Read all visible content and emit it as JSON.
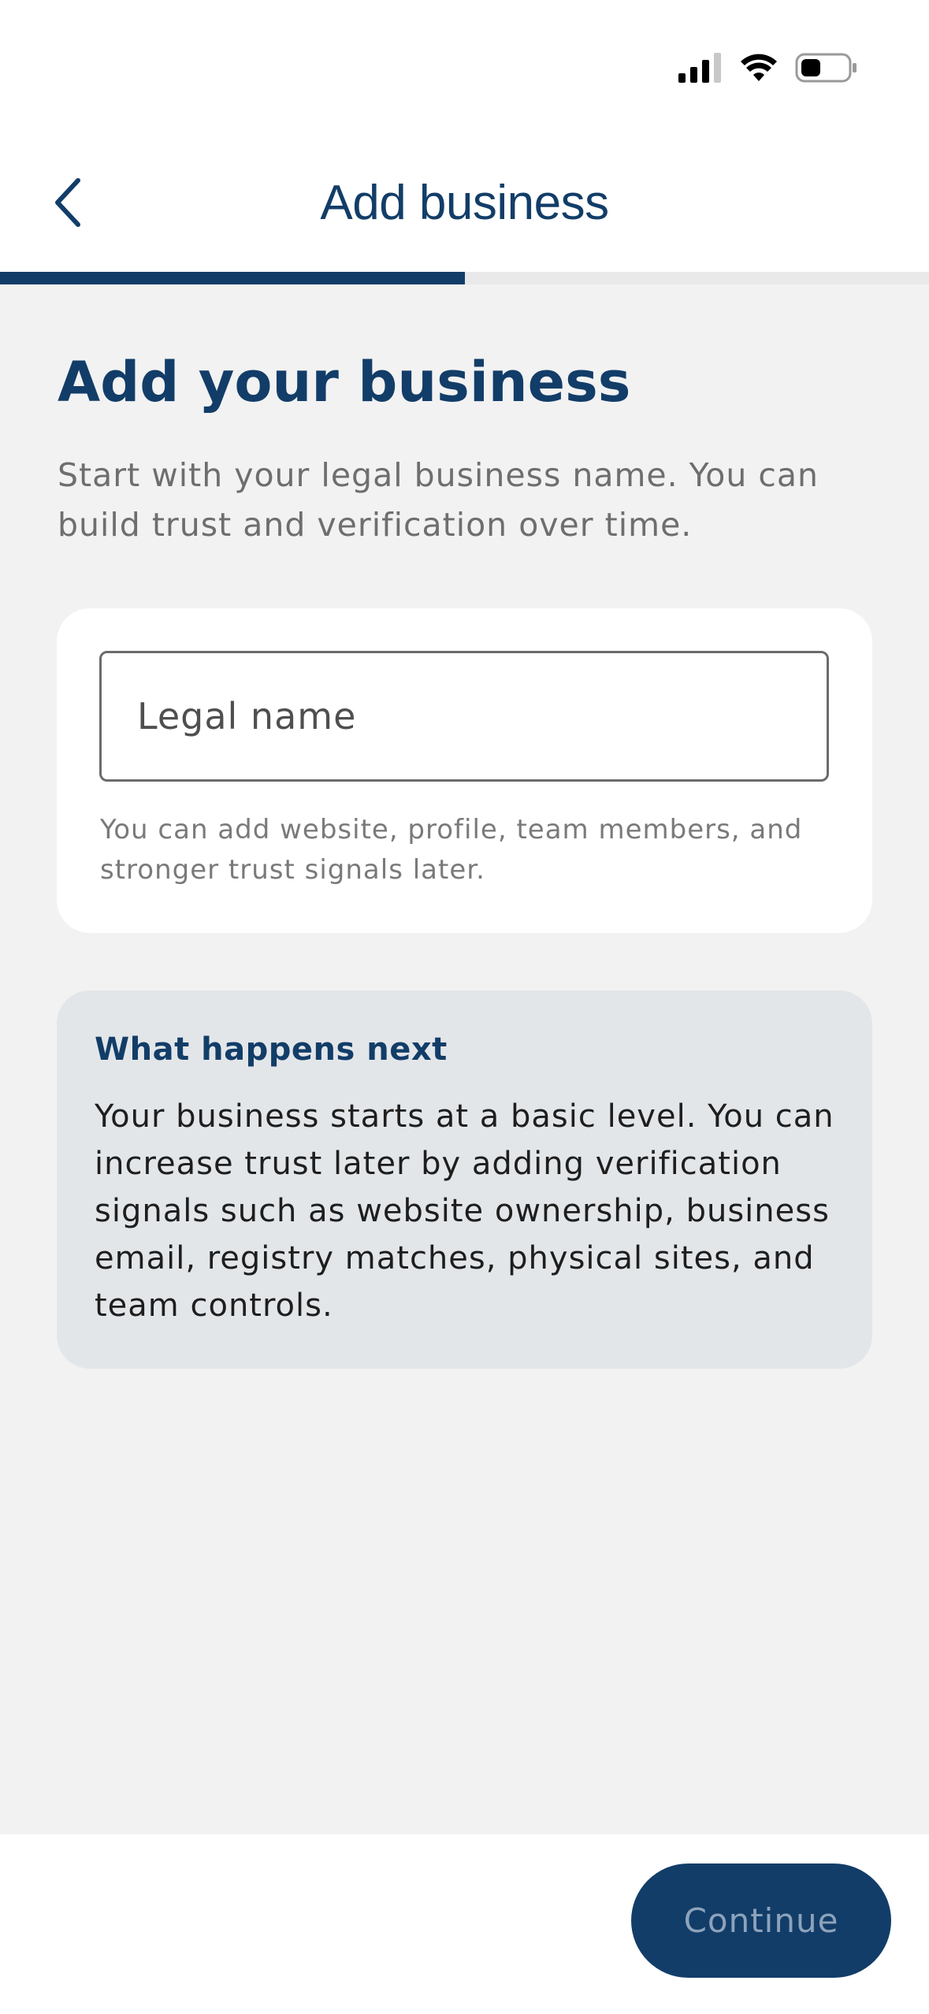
{
  "header": {
    "title": "Add business",
    "back_icon": "chevron-left-icon"
  },
  "status_bar": {
    "icons": [
      "cellular-signal-icon",
      "wifi-icon",
      "battery-icon"
    ]
  },
  "progress": {
    "value_percent": 50
  },
  "main": {
    "heading": "Add your business",
    "subtitle": "Start with your legal business name. You can build trust and verification over time."
  },
  "form": {
    "legal_name_placeholder": "Legal name",
    "legal_name_value": "",
    "helper": "You can add website, profile, team members, and stronger trust signals later."
  },
  "info": {
    "title": "What happens next",
    "body": "Your business starts at a basic level. You can increase trust later by adding verification signals such as website ownership, business email, registry matches, physical sites, and team controls."
  },
  "footer": {
    "continue_label": "Continue"
  },
  "colors": {
    "brand": "#123d68",
    "background": "#f2f2f2",
    "info_card": "#e3e6e9"
  }
}
